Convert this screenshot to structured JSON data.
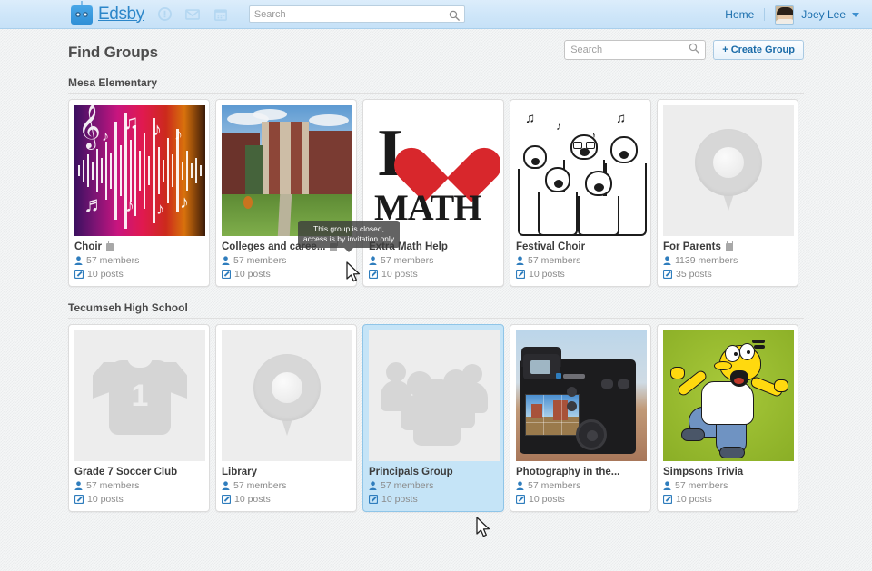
{
  "topbar": {
    "brand": "Edsby",
    "icons": [
      "alert-icon",
      "mail-icon",
      "calendar-icon"
    ],
    "search_placeholder": "Search",
    "search_value": "",
    "home_label": "Home",
    "user_name": "Joey Lee"
  },
  "page": {
    "title": "Find Groups",
    "search_placeholder": "Search",
    "search_value": "",
    "create_button": "+ Create Group"
  },
  "tooltip": {
    "text": "This group is closed, access is by invitation only"
  },
  "sections": [
    {
      "label": "Mesa Elementary",
      "cards": [
        {
          "title": "Choir",
          "members": "57 members",
          "posts": "10 posts",
          "locked": true,
          "thumb": "music-waveform-image",
          "selected": false
        },
        {
          "title": "Colleges and caree...",
          "members": "57 members",
          "posts": "10 posts",
          "locked": true,
          "thumb": "college-campus-image",
          "selected": false
        },
        {
          "title": "Extra Math Help",
          "members": "57 members",
          "posts": "10 posts",
          "locked": false,
          "thumb": "i-love-math-image",
          "selected": false
        },
        {
          "title": "Festival Choir",
          "members": "57 members",
          "posts": "10 posts",
          "locked": false,
          "thumb": "singing-choir-sketch-image",
          "selected": false
        },
        {
          "title": "For Parents",
          "members": "1139 members",
          "posts": "35 posts",
          "locked": true,
          "thumb": "map-pin-placeholder",
          "selected": false
        }
      ]
    },
    {
      "label": "Tecumseh High School",
      "cards": [
        {
          "title": "Grade 7 Soccer Club",
          "members": "57 members",
          "posts": "10 posts",
          "locked": false,
          "thumb": "jersey-placeholder",
          "selected": false
        },
        {
          "title": "Library",
          "members": "57 members",
          "posts": "10 posts",
          "locked": false,
          "thumb": "map-pin-placeholder",
          "selected": false
        },
        {
          "title": "Principals Group",
          "members": "57 members",
          "posts": "10 posts",
          "locked": false,
          "thumb": "people-group-placeholder",
          "selected": true
        },
        {
          "title": "Photography in the...",
          "members": "57 members",
          "posts": "10 posts",
          "locked": false,
          "thumb": "dslr-camera-image",
          "selected": false
        },
        {
          "title": "Simpsons Trivia",
          "members": "57 members",
          "posts": "10 posts",
          "locked": false,
          "thumb": "homer-simpson-image",
          "selected": false
        }
      ]
    }
  ],
  "colors": {
    "topbar": "#cfe6f9",
    "link": "#1c6fad",
    "selected_card": "#c5e4f7",
    "meta_icon": "#2f7dbd"
  }
}
